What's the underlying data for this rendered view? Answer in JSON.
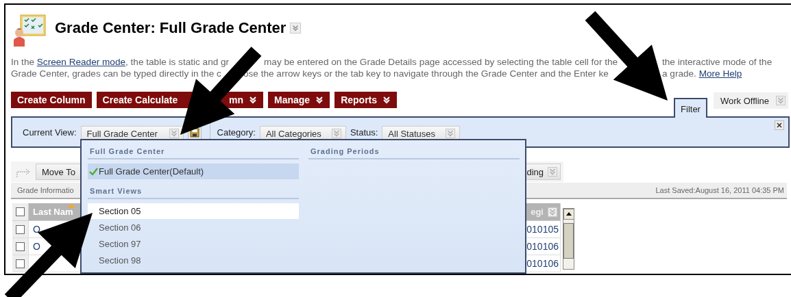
{
  "page_title": "Grade Center: Full Grade Center",
  "help_text": [
    [
      [
        {
          "kind": "text",
          "text": "In the "
        },
        {
          "kind": "link",
          "text": "Screen Reader mode"
        },
        {
          "kind": "text",
          "text": ", the table is static and gr"
        }
      ],
      [
        {
          "kind": "text",
          "text": "may be entered on the Grade Details page accessed by selecting the table cell for the"
        }
      ],
      [
        {
          "kind": "text",
          "text": "the interactive mode of the"
        }
      ]
    ],
    [
      [
        {
          "kind": "text",
          "text": "Grade Center, grades can be typed directly in the c"
        }
      ],
      [
        {
          "kind": "text",
          "text": "ose the arrow keys or the tab key to navigate through the Grade Center and the Enter ke"
        }
      ],
      [
        {
          "kind": "text",
          "text": "a grade. "
        },
        {
          "kind": "link",
          "text": "More Help"
        }
      ]
    ]
  ],
  "action_buttons": [
    {
      "label": [
        "Create Column"
      ],
      "menu": false
    },
    {
      "label": [
        "Create Calculate",
        "mn"
      ],
      "menu": true
    },
    {
      "label": [
        "Manage"
      ],
      "menu": true
    },
    {
      "label": [
        "Reports"
      ],
      "menu": true
    }
  ],
  "tabs": [
    {
      "label": "Filter",
      "selected": true
    },
    {
      "label": "Work Offline",
      "selected": false
    }
  ],
  "filters": [
    {
      "label": "Current View:",
      "value": "Full Grade Center"
    },
    {
      "label": "Category:",
      "value": "All Categories"
    },
    {
      "label": "Status:",
      "value": "All Statuses"
    }
  ],
  "view_menu": {
    "columns": [
      {
        "groups": [
          {
            "heading": "Full Grade Center",
            "items": [
              {
                "label": "Full Grade Center(Default)",
                "selected": true,
                "hovered": false
              }
            ]
          },
          {
            "heading": "Smart Views",
            "items": [
              {
                "label": "Section 05",
                "selected": false,
                "hovered": true
              },
              {
                "label": "Section 06",
                "selected": false,
                "hovered": false
              },
              {
                "label": "Section 97",
                "selected": false,
                "hovered": false
              },
              {
                "label": "Section 98",
                "selected": false,
                "hovered": false
              }
            ]
          }
        ]
      },
      {
        "groups": [
          {
            "heading": "Grading Periods"
          }
        ]
      }
    ]
  },
  "grid_toolbar": [
    "Move To",
    "ding"
  ],
  "info_bar": {
    "label": "Grade Informatio",
    "last_saved": "Last Saved:August 16, 2011 04:35 PM"
  },
  "grid": {
    "header_checked": false,
    "columns": [
      "Last Nam",
      "egi"
    ],
    "rows": [
      {
        "checked": false,
        "name": "O",
        "value": "010105"
      },
      {
        "checked": false,
        "name": "O",
        "value": "010106"
      },
      {
        "checked": false,
        "value": "010106"
      }
    ]
  }
}
